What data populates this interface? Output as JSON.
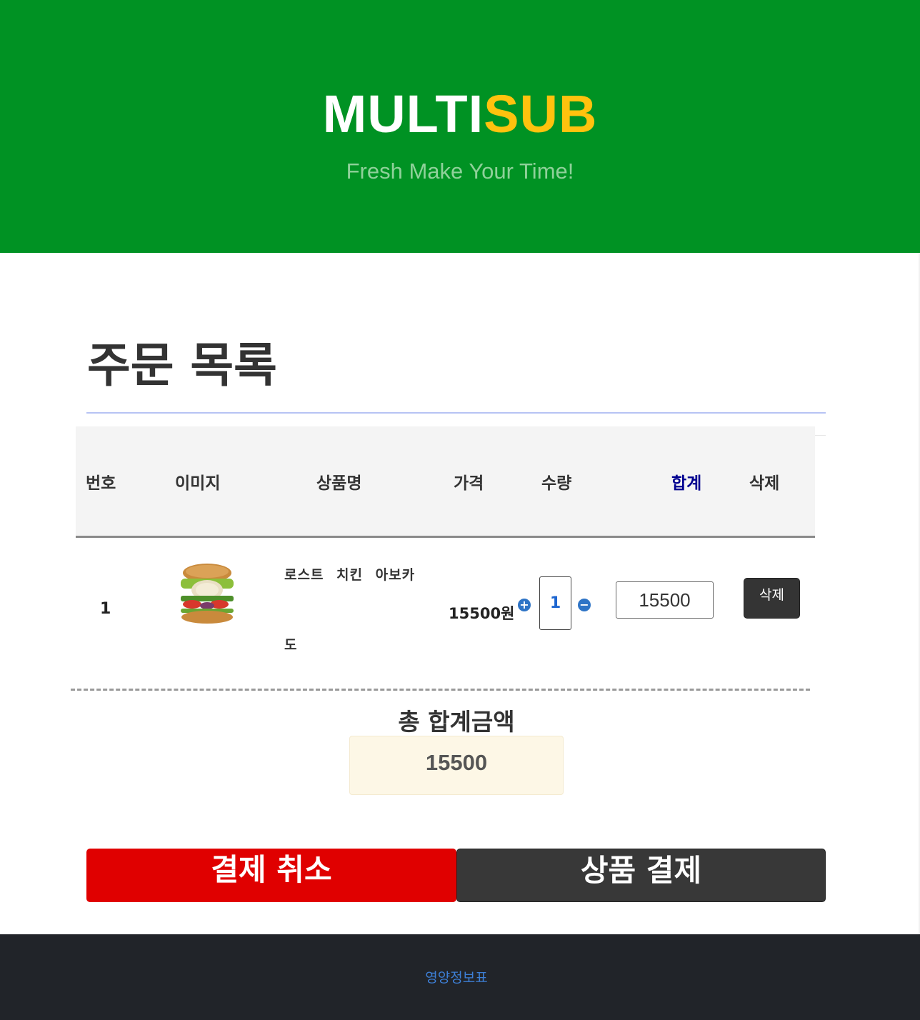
{
  "header": {
    "logo_part1": "MULTI",
    "logo_part2": "SUB",
    "tagline": "Fresh Make Your Time!"
  },
  "page_title": "주문 목록",
  "table": {
    "headers": {
      "no": "번호",
      "image": "이미지",
      "name": "상품명",
      "price": "가격",
      "qty": "수량",
      "total": "합계",
      "delete": "삭제"
    },
    "rows": [
      {
        "no": "1",
        "image_icon": "sandwich-image",
        "name_line1": "로스트 치킨 아보카",
        "name_line2": "도",
        "price": "15500원",
        "qty": "1",
        "subtotal": "15500",
        "delete_label": "삭제"
      }
    ]
  },
  "summary": {
    "label": "총 합계금액",
    "value": "15500"
  },
  "buttons": {
    "cancel": "결제 취소",
    "pay": "상품 결제"
  },
  "footer": {
    "link": "영양정보표"
  },
  "colors": {
    "header_bg": "#009223",
    "logo_accent": "#ffc20e",
    "cancel_bg": "#e00000",
    "pay_bg": "#383838",
    "footer_bg": "#212429",
    "total_header": "#000090"
  }
}
